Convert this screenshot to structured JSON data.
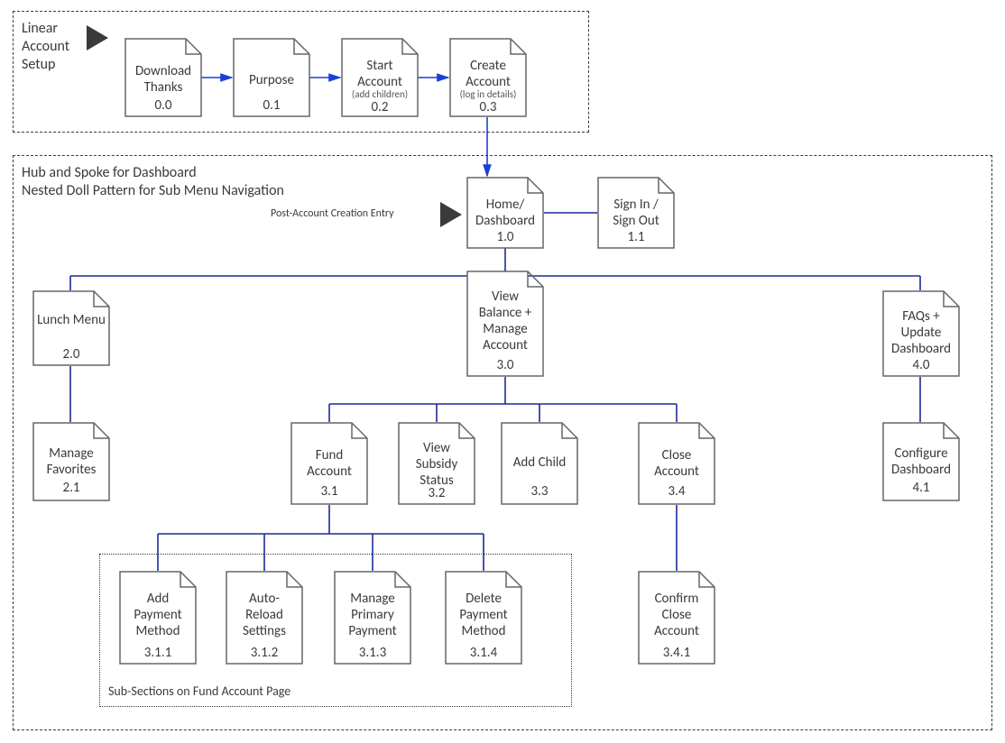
{
  "group1": {
    "title": "Linear\nAccount\nSetup"
  },
  "group2": {
    "title1": "Hub and Spoke for Dashboard",
    "title2": "Nested Doll Pattern for Sub Menu Navigation",
    "entryLabel": "Post-Account Creation Entry"
  },
  "group3": {
    "title": "Sub-Sections on Fund Account Page"
  },
  "nodes": {
    "n00": {
      "title": "Download\nThanks",
      "sub": "",
      "num": "0.0"
    },
    "n01": {
      "title": "Purpose",
      "sub": "",
      "num": "0.1"
    },
    "n02": {
      "title": "Start\nAccount",
      "sub": "(add children)",
      "num": "0.2"
    },
    "n03": {
      "title": "Create\nAccount",
      "sub": "(log in details)",
      "num": "0.3"
    },
    "n10": {
      "title": "Home/\nDashboard",
      "sub": "",
      "num": "1.0"
    },
    "n11": {
      "title": "Sign In /\nSign Out",
      "sub": "",
      "num": "1.1"
    },
    "n20": {
      "title": "Lunch\nMenu",
      "sub": "",
      "num": "2.0"
    },
    "n21": {
      "title": "Manage\nFavorites",
      "sub": "",
      "num": "2.1"
    },
    "n30": {
      "title": "View\nBalance +\nManage\nAccount",
      "sub": "",
      "num": "3.0"
    },
    "n31": {
      "title": "Fund\nAccount",
      "sub": "",
      "num": "3.1"
    },
    "n32": {
      "title": "View\nSubsidy\nStatus",
      "sub": "",
      "num": "3.2"
    },
    "n33": {
      "title": "Add Child",
      "sub": "",
      "num": "3.3"
    },
    "n34": {
      "title": "Close\nAccount",
      "sub": "",
      "num": "3.4"
    },
    "n311": {
      "title": "Add\nPayment\nMethod",
      "sub": "",
      "num": "3.1.1"
    },
    "n312": {
      "title": "Auto-\nReload\nSettings",
      "sub": "",
      "num": "3.1.2"
    },
    "n313": {
      "title": "Manage\nPrimary\nPayment",
      "sub": "",
      "num": "3.1.3"
    },
    "n314": {
      "title": "Delete\nPayment\nMethod",
      "sub": "",
      "num": "3.1.4"
    },
    "n341": {
      "title": "Confirm\nClose\nAccount",
      "sub": "",
      "num": "3.4.1"
    },
    "n40": {
      "title": "FAQs +\nUpdate\nDashboard",
      "sub": "",
      "num": "4.0"
    },
    "n41": {
      "title": "Configure\nDashboard",
      "sub": "",
      "num": "4.1"
    }
  }
}
